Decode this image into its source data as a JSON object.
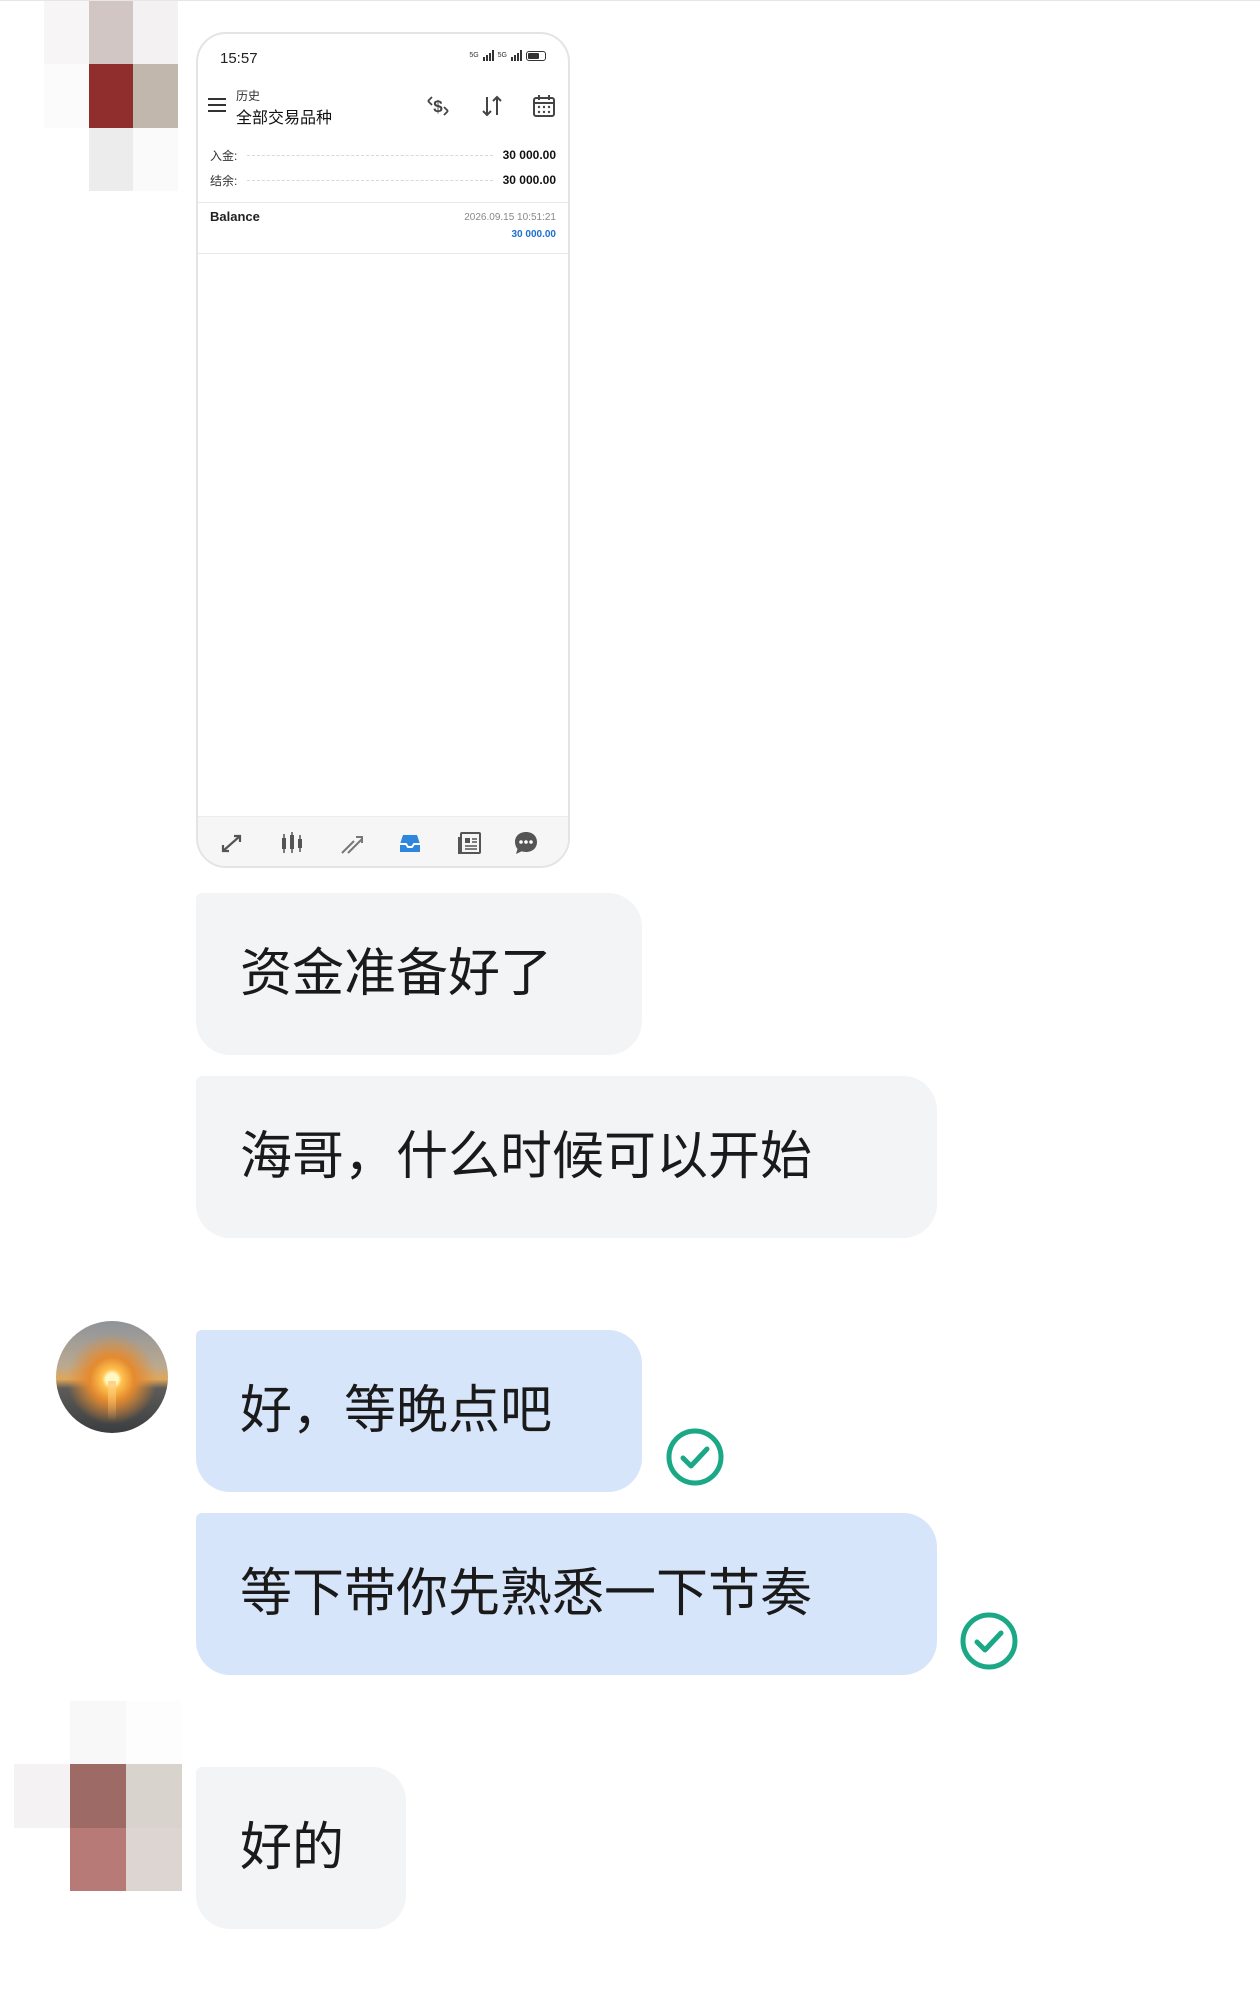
{
  "screenshot": {
    "status_time": "15:57",
    "network_label_1": "5G",
    "network_label_2": "5G",
    "subtitle": "历史",
    "title": "全部交易品种",
    "summary": [
      {
        "label": "入金:",
        "value": "30 000.00"
      },
      {
        "label": "结余:",
        "value": "30 000.00"
      }
    ],
    "entry": {
      "name": "Balance",
      "datetime": "2026.09.15 10:51:21",
      "amount": "30 000.00"
    },
    "toolbar_icons": [
      "deposit-filter-icon",
      "sort-icon",
      "calendar-icon"
    ],
    "tab_icons": [
      "quotes-icon",
      "chart-icon",
      "trade-icon",
      "history-icon",
      "news-icon",
      "messages-icon"
    ],
    "active_tab": "history-icon",
    "accent_color": "#1b6fd1"
  },
  "messages": [
    {
      "side": "incoming",
      "text": "资金准备好了"
    },
    {
      "side": "incoming",
      "text": "海哥，什么时候可以开始"
    },
    {
      "side": "outgoing",
      "text": "好，等晚点吧",
      "read": true
    },
    {
      "side": "outgoing",
      "text": "等下带你先熟悉一下节奏",
      "read": true
    },
    {
      "side": "incoming",
      "text": "好的"
    }
  ],
  "colors": {
    "incoming_bubble": "#f3f4f6",
    "outgoing_bubble": "#d7e5fb",
    "read_check": "#1aa886"
  }
}
